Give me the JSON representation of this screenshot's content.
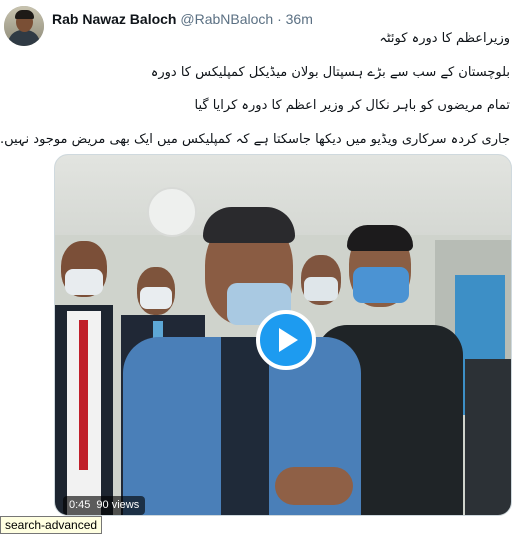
{
  "tweet": {
    "author": {
      "name": "Rab Nawaz Baloch",
      "handle": "@RabNBaloch",
      "separator": "·",
      "time": "36m"
    },
    "lines": [
      "وزیراعظم کا دورہ کوئٹہ",
      "بلوچستان کے سب سے بڑے ہسپتال بولان میڈیکل کمپلیکس کا دورہ",
      "تمام مریضوں کو باہر نکال کر وزیر اعظم کا دورہ کرایا گیا",
      "جاری کردہ سرکاری ویڈیو میں دیکھا جاسکتا ہے کہ کمپلیکس میں ایک بھی مریض موجود نہیں."
    ]
  },
  "video": {
    "duration": "0:45",
    "views": "90 views",
    "play_icon": "play-icon",
    "accent": "#1d9bf0"
  },
  "tooltip": {
    "text": "search-advanced"
  }
}
